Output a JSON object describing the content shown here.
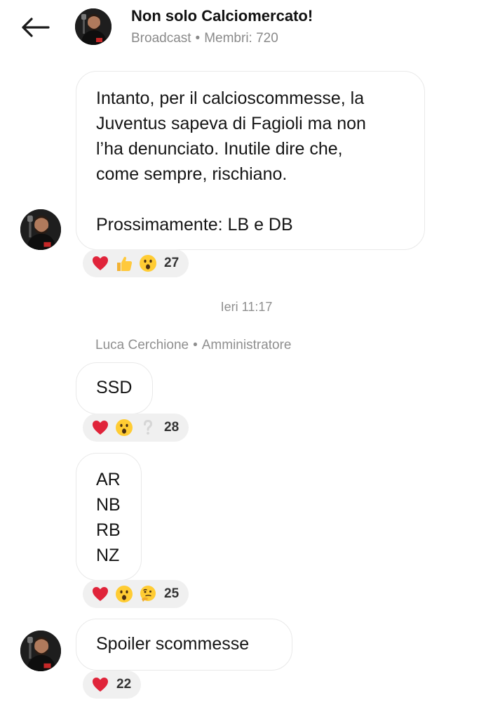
{
  "header": {
    "title": "Non solo Calciomercato!",
    "channel_type": "Broadcast",
    "members_label": "Membri: 720",
    "separator": "•"
  },
  "messages": [
    {
      "lines": [
        "Intanto, per il calcioscommesse, la",
        "Juventus sapeva di Fagioli ma non",
        "l’ha denunciato. Inutile dire che,",
        "come sempre, rischiano.",
        "",
        "Prossimamente: LB e DB"
      ],
      "reactions": {
        "emojis": [
          "heart",
          "thumbs-up",
          "surprised-face"
        ],
        "count": "27"
      }
    },
    {
      "lines": [
        "SSD"
      ],
      "reactions": {
        "emojis": [
          "heart",
          "surprised-face",
          "question-mark"
        ],
        "count": "28"
      }
    },
    {
      "lines": [
        "AR",
        "NB",
        "RB",
        "NZ"
      ],
      "reactions": {
        "emojis": [
          "heart",
          "surprised-face",
          "thinking-face"
        ],
        "count": "25"
      }
    },
    {
      "lines": [
        "Spoiler scommesse"
      ],
      "reactions": {
        "emojis": [
          "heart"
        ],
        "count": "22"
      }
    }
  ],
  "timestamp_separator": "Ieri 11:17",
  "sender": {
    "name": "Luca Cerchione",
    "role": "Amministratore",
    "separator": "•"
  },
  "colors": {
    "background": "#ffffff",
    "bubble_border": "#e9e9e9",
    "reaction_bg": "#f0f0f0",
    "muted_text": "#8a8a8a",
    "heart": "#e0243a",
    "emoji_yellow": "#ffcc33"
  }
}
